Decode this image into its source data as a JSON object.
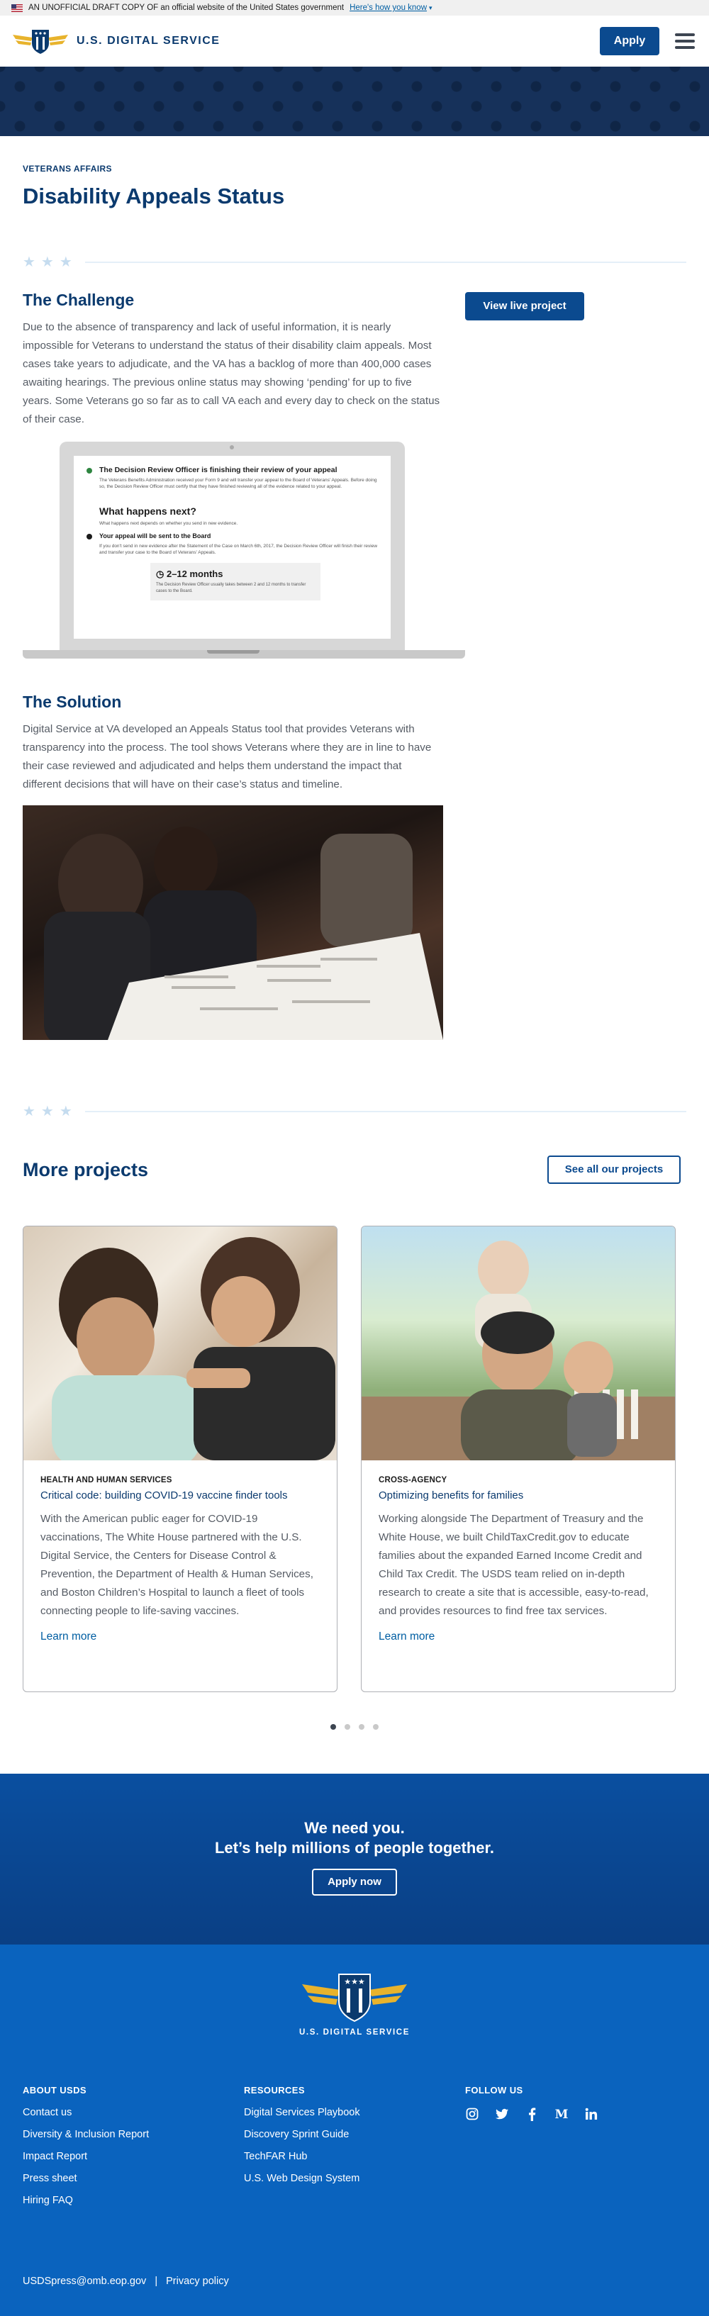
{
  "gov_banner": {
    "text": "AN UNOFFICIAL DRAFT COPY OF an official website of the United States government",
    "link": "Here's how you know"
  },
  "header": {
    "brand": "U.S. DIGITAL SERVICE",
    "apply_label": "Apply"
  },
  "page": {
    "eyebrow": "VETERANS AFFAIRS",
    "title": "Disability Appeals Status"
  },
  "challenge": {
    "heading": "The Challenge",
    "body": "Due to the absence of transparency and lack of useful information, it is nearly impossible for Veterans to understand the status of their disability claim appeals. Most cases take years to adjudicate, and the VA has a backlog of more than 400,000 cases awaiting hearings. The previous online status may showing ‘pending’ for up to five years. Some Veterans go so far as to call VA each and every day to check on the status of their case.",
    "button_label": "View live project"
  },
  "mockup": {
    "step1_title": "The Decision Review Officer is finishing their review of your appeal",
    "step1_text": "The Veterans Benefits Administration received your Form 9 and will transfer your appeal to the Board of Veterans' Appeals. Before doing so, the Decision Review Officer must certify that they have finished reviewing all of the evidence related to your appeal.",
    "next_heading": "What happens next?",
    "next_sub": "What happens next depends on whether you send in new evidence.",
    "step2_title": "Your appeal will be sent to the Board",
    "step2_text": "If you don't send in new evidence after the Statement of the Case on March 6th, 2017, the Decision Review Officer will finish their review and transfer your case to the Board of Veterans' Appeals.",
    "months": "2–12 months",
    "months_text": "The Decision Review Officer usually takes between 2 and 12 months to transfer cases to the Board."
  },
  "solution": {
    "heading": "The Solution",
    "body": "Digital Service at VA developed an Appeals Status tool that provides Veterans with transparency into the process. The tool shows Veterans where they are in line to have their case reviewed and adjudicated and helps them understand the impact that different decisions that will have on their case’s status and timeline."
  },
  "more_projects": {
    "title": "More projects",
    "see_all_label": "See all our projects",
    "cards": [
      {
        "eyebrow": "HEALTH AND HUMAN SERVICES",
        "subtitle": "Critical code: building COVID-19 vaccine finder tools",
        "text": "With the American public eager for COVID-19 vaccinations, The White House partnered with the U.S. Digital Service, the Centers for Disease Control & Prevention, the Department of Health & Human Services, and Boston Children’s Hospital to launch a fleet of tools connecting people to life-saving vaccines.",
        "link": "Learn more"
      },
      {
        "eyebrow": "CROSS-AGENCY",
        "subtitle": "Optimizing benefits for families",
        "text": "Working alongside The Department of Treasury and the White House, we built ChildTaxCredit.gov to educate families about the expanded Earned Income Credit and Child Tax Credit. The USDS team relied on in-depth research to create a site that is accessible, easy-to-read, and provides resources to find free tax services.",
        "link": "Learn more"
      }
    ]
  },
  "cta": {
    "line1": "We need you.",
    "line2": "Let’s help millions of people together.",
    "button_label": "Apply now"
  },
  "footer": {
    "brand": "U.S. DIGITAL SERVICE",
    "about": {
      "heading": "ABOUT USDS",
      "links": [
        "Contact us",
        "Diversity & Inclusion Report",
        "Impact Report",
        "Press sheet",
        "Hiring FAQ"
      ]
    },
    "resources": {
      "heading": "RESOURCES",
      "links": [
        "Digital Services Playbook",
        "Discovery Sprint Guide",
        "TechFAR Hub",
        "U.S. Web Design System"
      ]
    },
    "follow": {
      "heading": "FOLLOW US",
      "icons": [
        "instagram-icon",
        "twitter-icon",
        "facebook-icon",
        "medium-icon",
        "linkedin-icon"
      ]
    },
    "email": "USDSpress@omb.eop.gov",
    "privacy": "Privacy policy"
  },
  "colors": {
    "navy": "#0b3a6e",
    "primary": "#0b4a8f",
    "footer": "#0a63be",
    "gold": "#e8b32c"
  }
}
